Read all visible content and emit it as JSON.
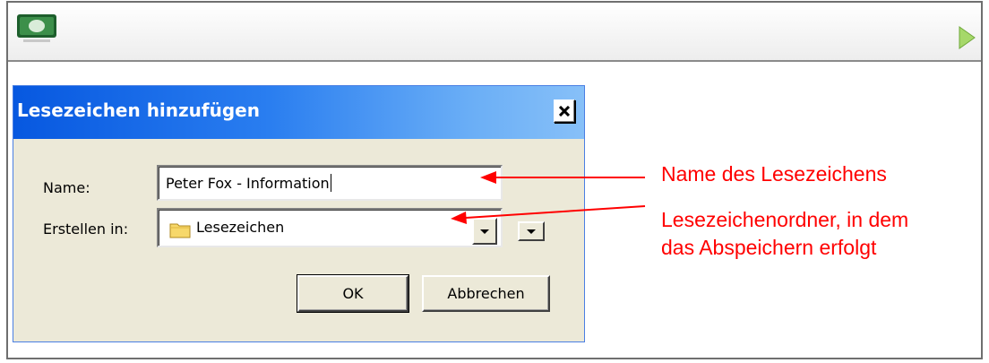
{
  "dialog": {
    "title": "Lesezeichen hinzufügen",
    "name_label": "Name:",
    "name_value": "Peter Fox - Information",
    "create_in_label": "Erstellen in:",
    "folder_value": "Lesezeichen",
    "ok_label": "OK",
    "cancel_label": "Abbrechen"
  },
  "annotations": {
    "name": "Name des Lesezeichens",
    "folder_line1": "Lesezeichenordner, in dem",
    "folder_line2": "das Abspeichern erfolgt"
  },
  "icons": {
    "app": "app-monitor-icon",
    "play": "play-arrow-icon",
    "close": "close-icon",
    "folder": "folder-icon",
    "dropdown": "chevron-down-icon"
  },
  "colors": {
    "titlebar": "#0758e0",
    "annotation": "#ff0000",
    "dialog_bg": "#ece9d8"
  }
}
